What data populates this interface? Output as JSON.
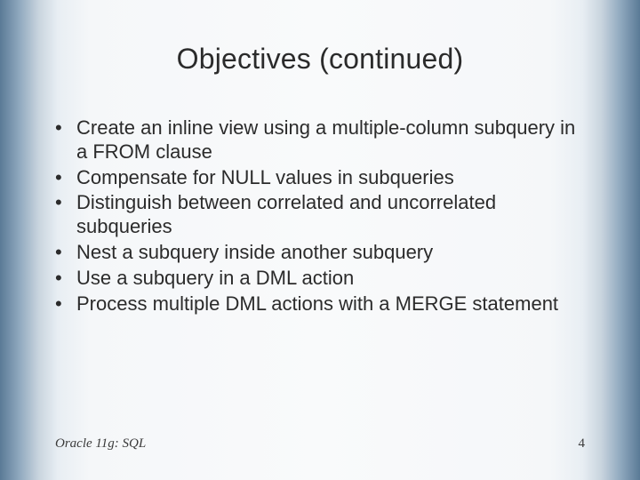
{
  "title": "Objectives (continued)",
  "bullets": [
    "Create an inline view using a multiple-column subquery in a FROM clause",
    "Compensate for NULL values in subqueries",
    "Distinguish between correlated and uncorrelated subqueries",
    "Nest a subquery inside another subquery",
    "Use a subquery in a DML action",
    "Process multiple DML actions with a MERGE statement"
  ],
  "footer": {
    "source": "Oracle 11g: SQL",
    "page": "4"
  }
}
